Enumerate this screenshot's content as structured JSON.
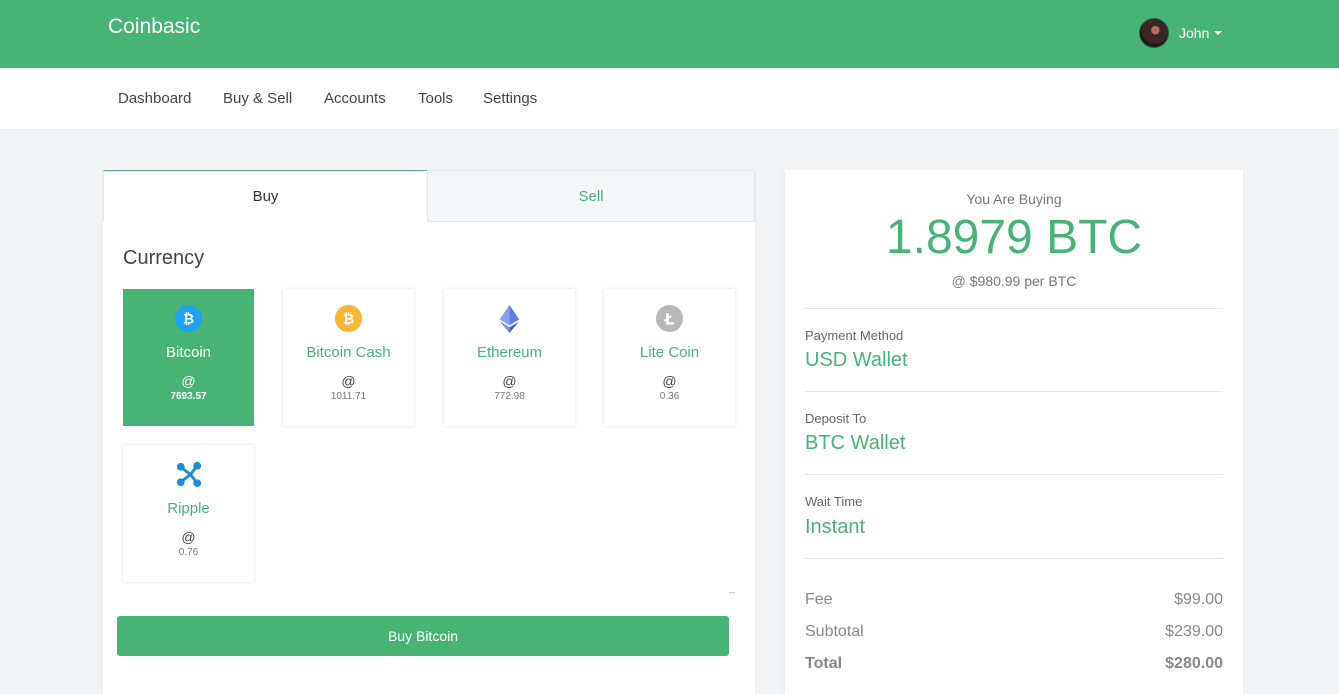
{
  "app": {
    "brand": "Coinbasic",
    "user_name": "John"
  },
  "nav": {
    "items": [
      "Dashboard",
      "Buy & Sell",
      "Accounts",
      "Tools",
      "Settings"
    ]
  },
  "tabs": {
    "buy": "Buy",
    "sell": "Sell",
    "active": "Buy"
  },
  "currency": {
    "title": "Currency",
    "selected": "Bitcoin",
    "at_symbol": "@",
    "coins": [
      {
        "name": "Bitcoin",
        "price": "7693.57",
        "icon": "bitcoin-icon",
        "color": "#1da1f2"
      },
      {
        "name": "Bitcoin Cash",
        "price": "1011.71",
        "icon": "bitcoin-cash-icon",
        "color": "#f7b733"
      },
      {
        "name": "Ethereum",
        "price": "772.98",
        "icon": "ethereum-icon",
        "color": "#627eea"
      },
      {
        "name": "Lite Coin",
        "price": "0.36",
        "icon": "litecoin-icon",
        "color": "#b8b8b8"
      },
      {
        "name": "Ripple",
        "price": "0.76",
        "icon": "ripple-icon",
        "color": "#1a8fd3"
      }
    ]
  },
  "action": {
    "buy_button": "Buy Bitcoin"
  },
  "summary": {
    "caption": "You Are Buying",
    "amount": "1.8979 BTC",
    "rate": "@ $980.99 per BTC",
    "payment_label": "Payment Method",
    "payment_value": "USD Wallet",
    "deposit_label": "Deposit To",
    "deposit_value": "BTC Wallet",
    "wait_label": "Wait Time",
    "wait_value": "Instant",
    "fee_label": "Fee",
    "fee_value": "$99.00",
    "subtotal_label": "Subtotal",
    "subtotal_value": "$239.00",
    "total_label": "Total",
    "total_value": "$280.00"
  },
  "colors": {
    "accent": "#47b475",
    "background": "#f1f5f8"
  }
}
